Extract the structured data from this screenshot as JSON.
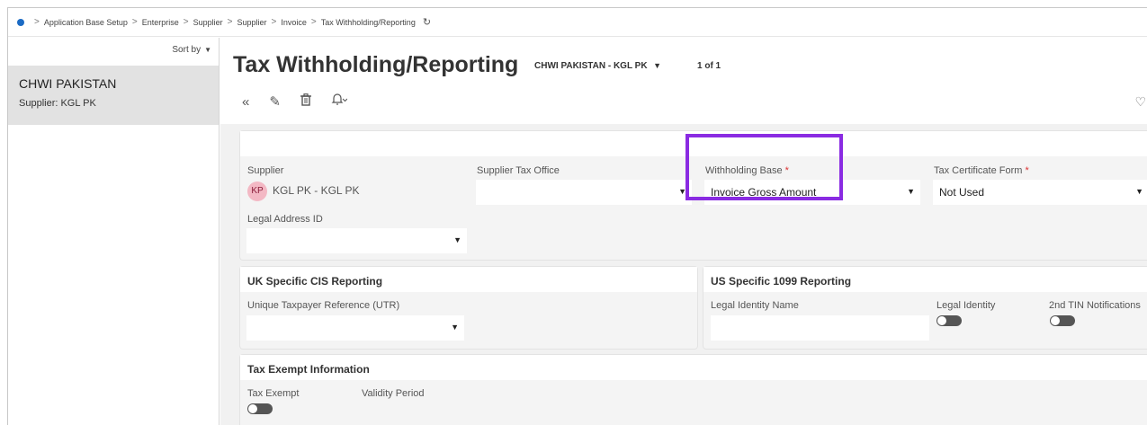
{
  "breadcrumb": {
    "items": [
      "Application Base Setup",
      "Enterprise",
      "Supplier",
      "Supplier",
      "Invoice",
      "Tax Withholding/Reporting"
    ]
  },
  "leftpanel": {
    "sort_label": "Sort by",
    "record_name": "CHWI PAKISTAN",
    "record_sub": "Supplier:  KGL PK"
  },
  "header": {
    "title": "Tax Withholding/Reporting",
    "subtitle": "CHWI PAKISTAN - KGL PK",
    "count": "1 of 1"
  },
  "general": {
    "supplier_label": "Supplier",
    "supplier_avatar": "KP",
    "supplier_value": "KGL PK - KGL PK",
    "tax_office_label": "Supplier Tax Office",
    "tax_office_value": "",
    "withholding_base_label": "Withholding Base",
    "withholding_base_value": "Invoice Gross Amount",
    "tax_cert_label": "Tax Certificate Form",
    "tax_cert_value": "Not Used",
    "legal_address_label": "Legal Address ID",
    "legal_address_value": ""
  },
  "uk": {
    "title": "UK Specific CIS Reporting",
    "utr_label": "Unique Taxpayer Reference (UTR)",
    "utr_value": ""
  },
  "us": {
    "title": "US Specific 1099 Reporting",
    "legal_name_label": "Legal Identity Name",
    "legal_name_value": "",
    "legal_identity_label": "Legal Identity",
    "tin_label": "2nd TIN Notifications"
  },
  "exempt": {
    "title": "Tax Exempt Information",
    "tax_exempt_label": "Tax Exempt",
    "validity_label": "Validity Period"
  },
  "colors": {
    "highlight": "#8a2be2",
    "accent": "#1b6bc4"
  }
}
